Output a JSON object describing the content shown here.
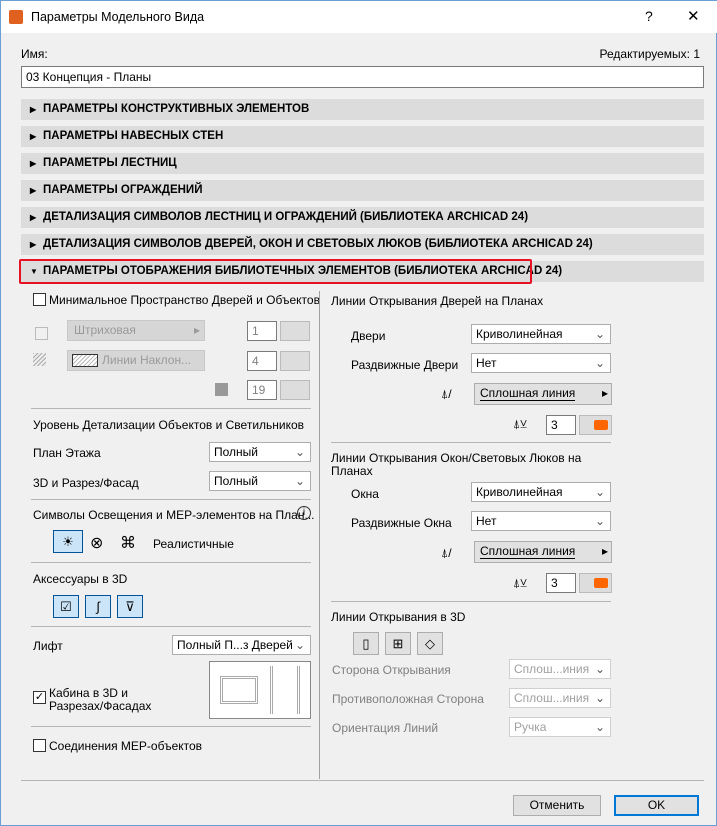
{
  "window": {
    "title": "Параметры Модельного Вида",
    "help": "?",
    "close": "✕"
  },
  "name_label": "Имя:",
  "edited_label": "Редактируемых: 1",
  "name_value": "03 Концепция - Планы",
  "sections": [
    "ПАРАМЕТРЫ КОНСТРУКТИВНЫХ ЭЛЕМЕНТОВ",
    "ПАРАМЕТРЫ НАВЕСНЫХ СТЕН",
    "ПАРАМЕТРЫ ЛЕСТНИЦ",
    "ПАРАМЕТРЫ ОГРАЖДЕНИЙ",
    "ДЕТАЛИЗАЦИЯ СИМВОЛОВ ЛЕСТНИЦ И ОГРАЖДЕНИЙ (БИБЛИОТЕКА ARCHICAD 24)",
    "ДЕТАЛИЗАЦИЯ СИМВОЛОВ ДВЕРЕЙ, ОКОН И СВЕТОВЫХ ЛЮКОВ (БИБЛИОТЕКА ARCHICAD 24)",
    "ПАРАМЕТРЫ ОТОБРАЖЕНИЯ БИБЛИОТЕЧНЫХ ЭЛЕМЕНТОВ (БИБЛИОТЕКА ARCHICAD 24)"
  ],
  "left": {
    "min_space": "Минимальное Пространство Дверей и Объектов",
    "line_type": "Штриховая",
    "fill_type": "Линии Наклон...",
    "pens": [
      "1",
      "4",
      "19"
    ],
    "detail_title": "Уровень Детализации Объектов и Светильников",
    "floor_plan": "План Этажа",
    "floor_plan_value": "Полный",
    "section3d": "3D и Разрез/Фасад",
    "section3d_value": "Полный",
    "light_title": "Символы Освещения и МЕР-элементов на План...",
    "light_mode": "Реалистичные",
    "accessories": "Аксессуары в 3D",
    "lift": "Лифт",
    "lift_value": "Полный П...з Дверей",
    "cabin": "Кабина в 3D и Разрезах/Фасадах",
    "mep": "Соединения МЕР-объектов"
  },
  "right": {
    "door_title": "Линии Открывания Дверей на Планах",
    "doors": "Двери",
    "doors_value": "Криволинейная",
    "sliding_doors": "Раздвижные Двери",
    "sliding_doors_value": "Нет",
    "line1": "Сплошная линия",
    "pen1": "3",
    "window_title": "Линии Открывания Окон/Световых Люков на Планах",
    "windows": "Окна",
    "windows_value": "Криволинейная",
    "sliding_windows": "Раздвижные Окна",
    "sliding_windows_value": "Нет",
    "line2": "Сплошная линия",
    "pen2": "3",
    "open3d_title": "Линии Открывания в 3D",
    "open_side": "Сторона Открывания",
    "open_side_value": "Сплош...иния",
    "opp_side": "Противоположная Сторона",
    "opp_side_value": "Сплош...иния",
    "orient": "Ориентация Линий",
    "orient_value": "Ручка"
  },
  "buttons": {
    "cancel": "Отменить",
    "ok": "OK"
  },
  "colors": {
    "accent": "#ff6600",
    "highlight": "#e81123"
  }
}
